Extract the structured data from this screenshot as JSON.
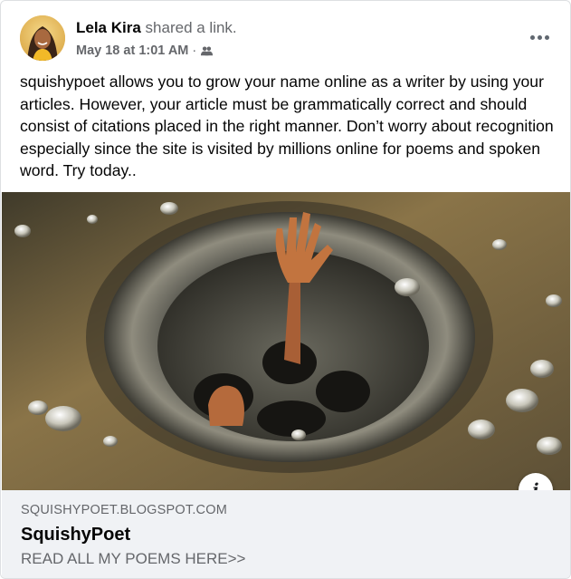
{
  "post": {
    "author": "Lela Kira",
    "action": "shared a link.",
    "timestamp": "May 18 at 1:01 AM",
    "separator": "·",
    "privacy_icon": "friends-icon",
    "more_icon": "more-options-icon",
    "text": "squishypoet allows you to grow your name online as a writer by using your articles. However, your article must be grammatically correct and should consist of citations placed in the right manner. Don’t worry about recognition especially since the site is visited by millions online for poems and spoken word. Try today.."
  },
  "link_preview": {
    "domain": "SQUISHYPOET.BLOGSPOT.COM",
    "title": "SquishyPoet",
    "description": "READ ALL MY POEMS HERE>>",
    "info_label": "i"
  },
  "colors": {
    "text_primary": "#050505",
    "text_secondary": "#65676b",
    "preview_bg": "#f0f2f5",
    "border": "#dddfe2"
  }
}
